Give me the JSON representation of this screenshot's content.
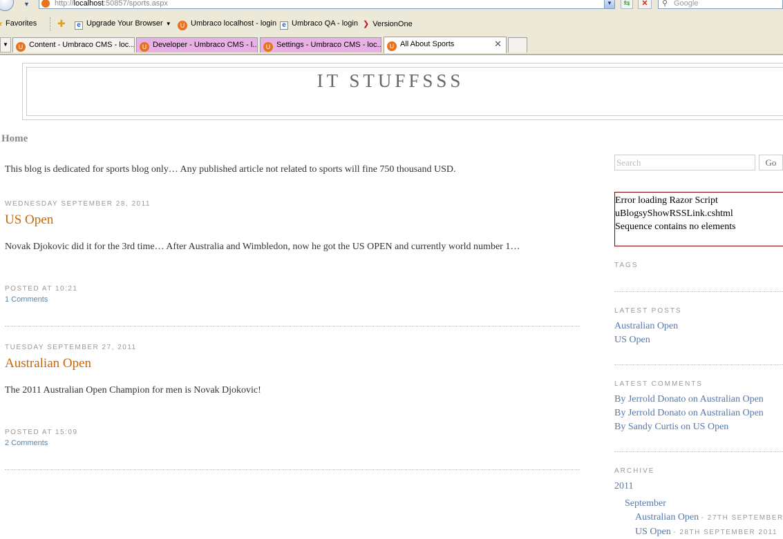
{
  "browser": {
    "url_prefix": "http://",
    "url_host": "localhost",
    "url_rest": ":50857/sports.aspx",
    "search_placeholder": "Google",
    "favorites_label": "Favorites",
    "bookmarks": [
      {
        "label": "Upgrade Your Browser",
        "icon": "ie-icon"
      },
      {
        "label": "Umbraco localhost - login",
        "icon": "umbraco-icon"
      },
      {
        "label": "Umbraco QA - login",
        "icon": "ie-icon"
      },
      {
        "label": "VersionOne",
        "icon": "versionone-icon"
      }
    ],
    "tabs": [
      {
        "label": "Content - Umbraco CMS - loc..."
      },
      {
        "label": "Developer - Umbraco CMS - l..."
      },
      {
        "label": "Settings - Umbraco CMS - loc..."
      },
      {
        "label": "All About Sports"
      }
    ]
  },
  "site": {
    "title": "IT STUFFSSS",
    "home_label": "Home",
    "intro": "This blog is dedicated for sports blog only… Any published article not related to sports will fine 750 thousand USD."
  },
  "posts": [
    {
      "date": "WEDNESDAY SEPTEMBER 28, 2011",
      "title": "US Open",
      "body": "Novak Djokovic did it for the 3rd time… After Australia and Wimbledon, now he got the US OPEN and currently world number 1…",
      "posted": "POSTED AT 10:21",
      "comments": "1 Comments"
    },
    {
      "date": "TUESDAY SEPTEMBER 27, 2011",
      "title": "Australian Open",
      "body": "The 2011 Australian Open Champion for men is Novak Djokovic!",
      "posted": "POSTED AT 15:09",
      "comments": "2 Comments"
    }
  ],
  "sidebar": {
    "search_placeholder": "Search",
    "go_label": "Go",
    "error_lines": [
      "Error loading Razor Script",
      "uBlogsyShowRSSLink.cshtml",
      "Sequence contains no elements"
    ],
    "tags_heading": "TAGS",
    "latest_posts_heading": "LATEST POSTS",
    "latest_posts": [
      "Australian Open",
      "US Open"
    ],
    "latest_comments_heading": "LATEST COMMENTS",
    "latest_comments": [
      "By Jerrold Donato on Australian Open",
      "By Jerrold Donato on Australian Open",
      "By Sandy Curtis on US Open"
    ],
    "archive_heading": "ARCHIVE",
    "archive_year": "2011",
    "archive_month": "September",
    "archive_posts": [
      {
        "title": "Australian Open",
        "date": "27TH SEPTEMBER"
      },
      {
        "title": "US Open",
        "date": "28TH SEPTEMBER 2011"
      }
    ]
  }
}
